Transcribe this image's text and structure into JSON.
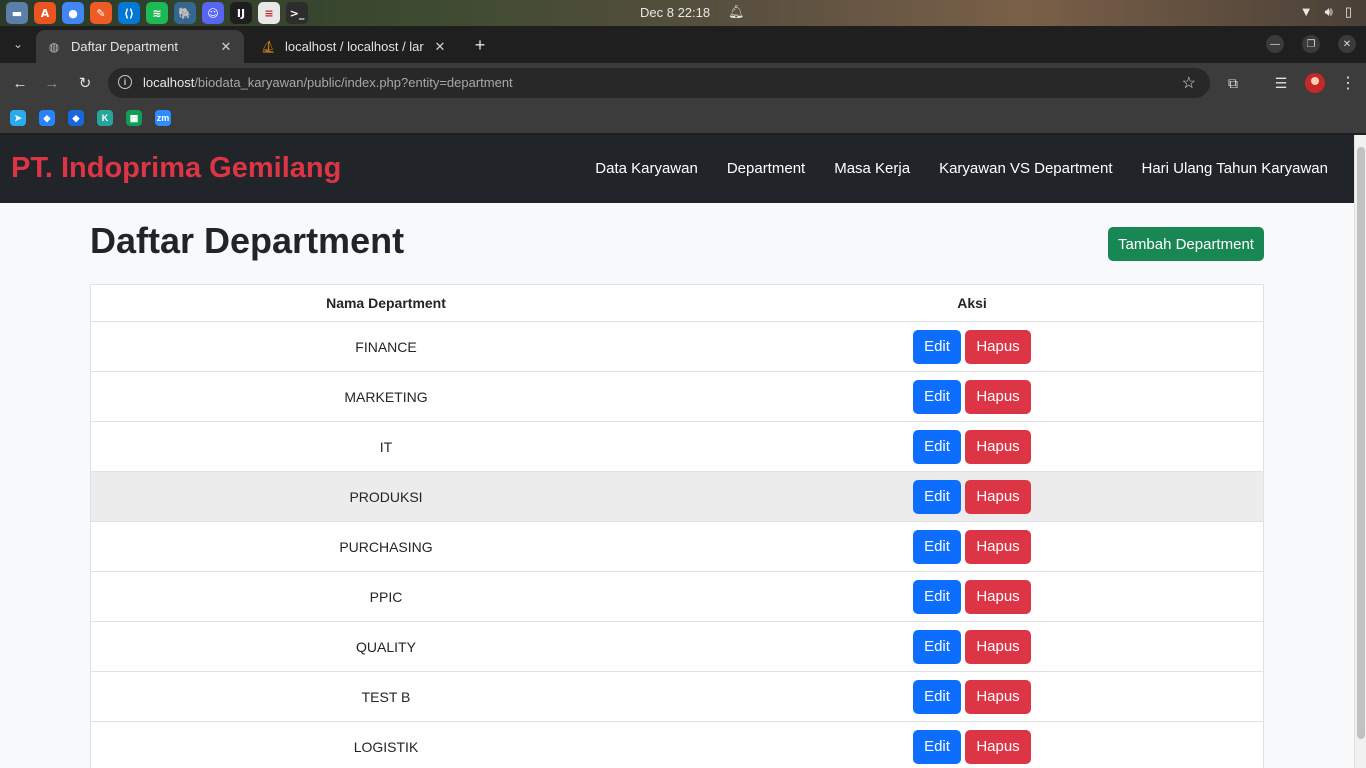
{
  "os": {
    "clock": "Dec 8  22:18",
    "apps": [
      {
        "icon": "files-icon",
        "glyph": "▬",
        "color": "#5b7fa8"
      },
      {
        "icon": "app-store-icon",
        "glyph": "A",
        "color": "#e95420"
      },
      {
        "icon": "chrome-icon",
        "glyph": "●",
        "color": "#4285f4"
      },
      {
        "icon": "postman-icon",
        "glyph": "✎",
        "color": "#ef5b25"
      },
      {
        "icon": "vscode-icon",
        "glyph": "⟨⟩",
        "color": "#0078d4"
      },
      {
        "icon": "spotify-icon",
        "glyph": "≋",
        "color": "#1db954"
      },
      {
        "icon": "postgres-icon",
        "glyph": "🐘",
        "color": "#336791"
      },
      {
        "icon": "discord-icon",
        "glyph": "☺",
        "color": "#5865f2"
      },
      {
        "icon": "intellij-icon",
        "glyph": "IJ",
        "color": "#1e1e1e"
      },
      {
        "icon": "text-editor-icon",
        "glyph": "≡",
        "color": "#e8e8e8"
      },
      {
        "icon": "terminal-icon",
        "glyph": ">_",
        "color": "#2d2d2d"
      }
    ]
  },
  "browser": {
    "tabs": [
      {
        "title": "Daftar Department",
        "active": true
      },
      {
        "title": "localhost / localhost / lar",
        "active": false
      }
    ],
    "url_host": "localhost",
    "url_path": "/biodata_karyawan/public/index.php?entity=department",
    "bookmarks": [
      {
        "icon": "telegram-bookmark-icon",
        "glyph": "➤",
        "color": "#2aabee"
      },
      {
        "icon": "jira-bookmark-icon",
        "glyph": "◆",
        "color": "#2684ff"
      },
      {
        "icon": "jira-alt-bookmark-icon",
        "glyph": "◆",
        "color": "#1868db"
      },
      {
        "icon": "k-bookmark-icon",
        "glyph": "K",
        "color": "#26a69a"
      },
      {
        "icon": "sheets-bookmark-icon",
        "glyph": "▦",
        "color": "#0f9d58"
      },
      {
        "icon": "zoom-bookmark-icon",
        "glyph": "zm",
        "color": "#2d8cff"
      }
    ]
  },
  "site": {
    "brand": "PT. Indoprima Gemilang",
    "nav": [
      "Data Karyawan",
      "Department",
      "Masa Kerja",
      "Karyawan VS Department",
      "Hari Ulang Tahun Karyawan"
    ],
    "page_title": "Daftar Department",
    "add_button": "Tambah Department",
    "table": {
      "headers": [
        "Nama Department",
        "Aksi"
      ],
      "rows": [
        "FINANCE",
        "MARKETING",
        "IT",
        "PRODUKSI",
        "PURCHASING",
        "PPIC",
        "QUALITY",
        "TEST B",
        "LOGISTIK"
      ],
      "hover_row": "PRODUKSI",
      "edit_label": "Edit",
      "delete_label": "Hapus"
    }
  },
  "colors": {
    "brand": "#dc3545",
    "navbar": "#212529",
    "add_button": "#198754",
    "edit_button": "#0d6efd",
    "delete_button": "#dc3545"
  }
}
